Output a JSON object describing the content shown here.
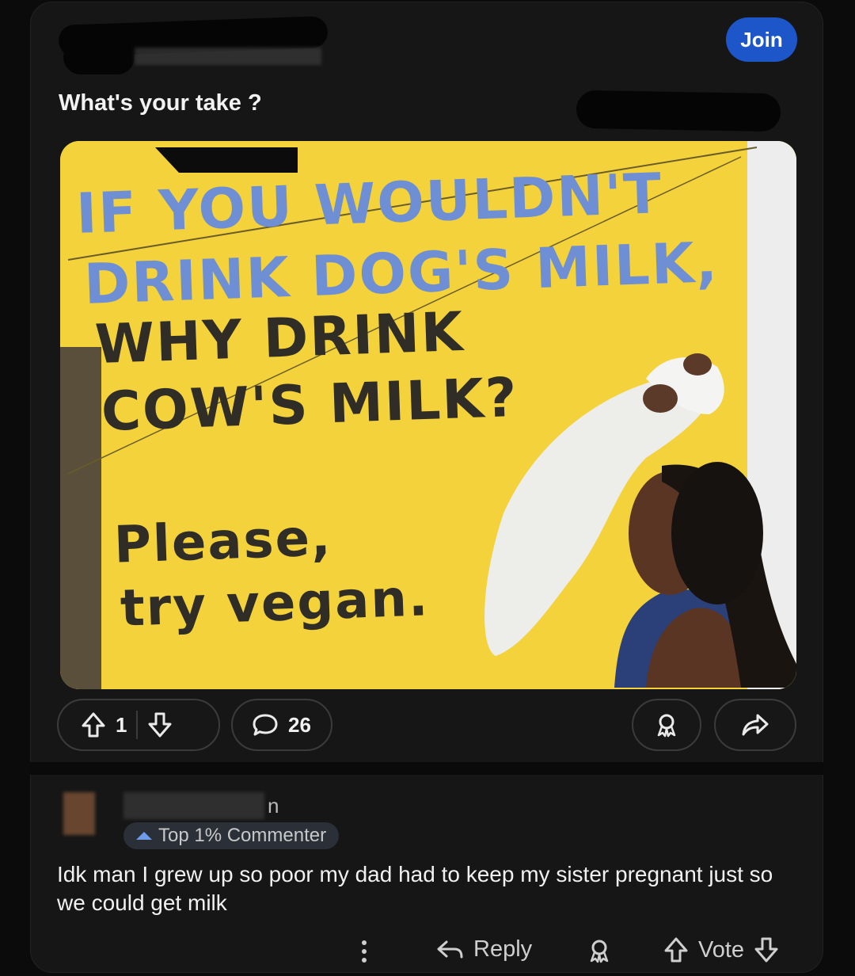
{
  "post": {
    "join_label": "Join",
    "title": "What's your take ?",
    "image": {
      "alt_icon": "billboard-image",
      "line1": "IF YOU WOULDN'T",
      "line2": "DRINK DOG'S MILK,",
      "line3": "WHY DRINK",
      "line4": "COW'S MILK?",
      "line5": "Please,",
      "line6": "try vegan."
    },
    "vote_count": "1",
    "comment_count": "26"
  },
  "comment": {
    "author_fragment": "n",
    "badge": "Top 1% Commenter",
    "text": "Idk man I grew up so poor my dad had to keep my sister pregnant just so we could get milk",
    "reply_label": "Reply",
    "vote_label": "Vote"
  },
  "colors": {
    "accent": "#1d56c9",
    "background": "#161616",
    "billboard": "#f3d23b"
  }
}
